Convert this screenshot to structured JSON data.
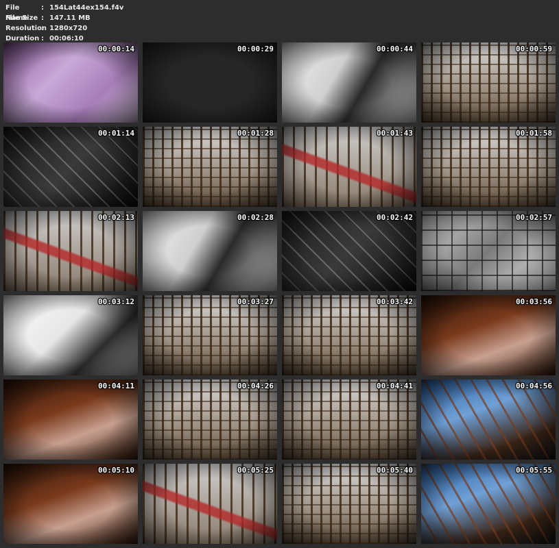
{
  "file_info": [
    {
      "key": "File Name",
      "value": "154Lat44ex154.f4v"
    },
    {
      "key": "File Size",
      "value": "147.11 MB"
    },
    {
      "key": "Resolution",
      "value": "1280x720"
    },
    {
      "key": "Duration",
      "value": "00:06:10"
    }
  ],
  "separator": ":",
  "thumbnails": [
    {
      "time": "00:00:14",
      "tone": "purple"
    },
    {
      "time": "00:00:29",
      "tone": "black"
    },
    {
      "time": "00:00:44",
      "tone": "white"
    },
    {
      "time": "00:00:59",
      "tone": "cage"
    },
    {
      "time": "00:01:14",
      "tone": "dark"
    },
    {
      "time": "00:01:28",
      "tone": "cage"
    },
    {
      "time": "00:01:43",
      "tone": "redpipe"
    },
    {
      "time": "00:01:58",
      "tone": "cage"
    },
    {
      "time": "00:02:13",
      "tone": "redpipe"
    },
    {
      "time": "00:02:28",
      "tone": "white"
    },
    {
      "time": "00:02:42",
      "tone": "dark"
    },
    {
      "time": "00:02:57",
      "tone": "bw"
    },
    {
      "time": "00:03:12",
      "tone": "bright"
    },
    {
      "time": "00:03:27",
      "tone": "cage"
    },
    {
      "time": "00:03:42",
      "tone": "cage"
    },
    {
      "time": "00:03:56",
      "tone": "brown"
    },
    {
      "time": "00:04:11",
      "tone": "brown"
    },
    {
      "time": "00:04:26",
      "tone": "cage"
    },
    {
      "time": "00:04:41",
      "tone": "cage"
    },
    {
      "time": "00:04:56",
      "tone": "blue"
    },
    {
      "time": "00:05:10",
      "tone": "brown"
    },
    {
      "time": "00:05:25",
      "tone": "redpipe"
    },
    {
      "time": "00:05:40",
      "tone": "cage"
    },
    {
      "time": "00:05:55",
      "tone": "blue"
    }
  ]
}
